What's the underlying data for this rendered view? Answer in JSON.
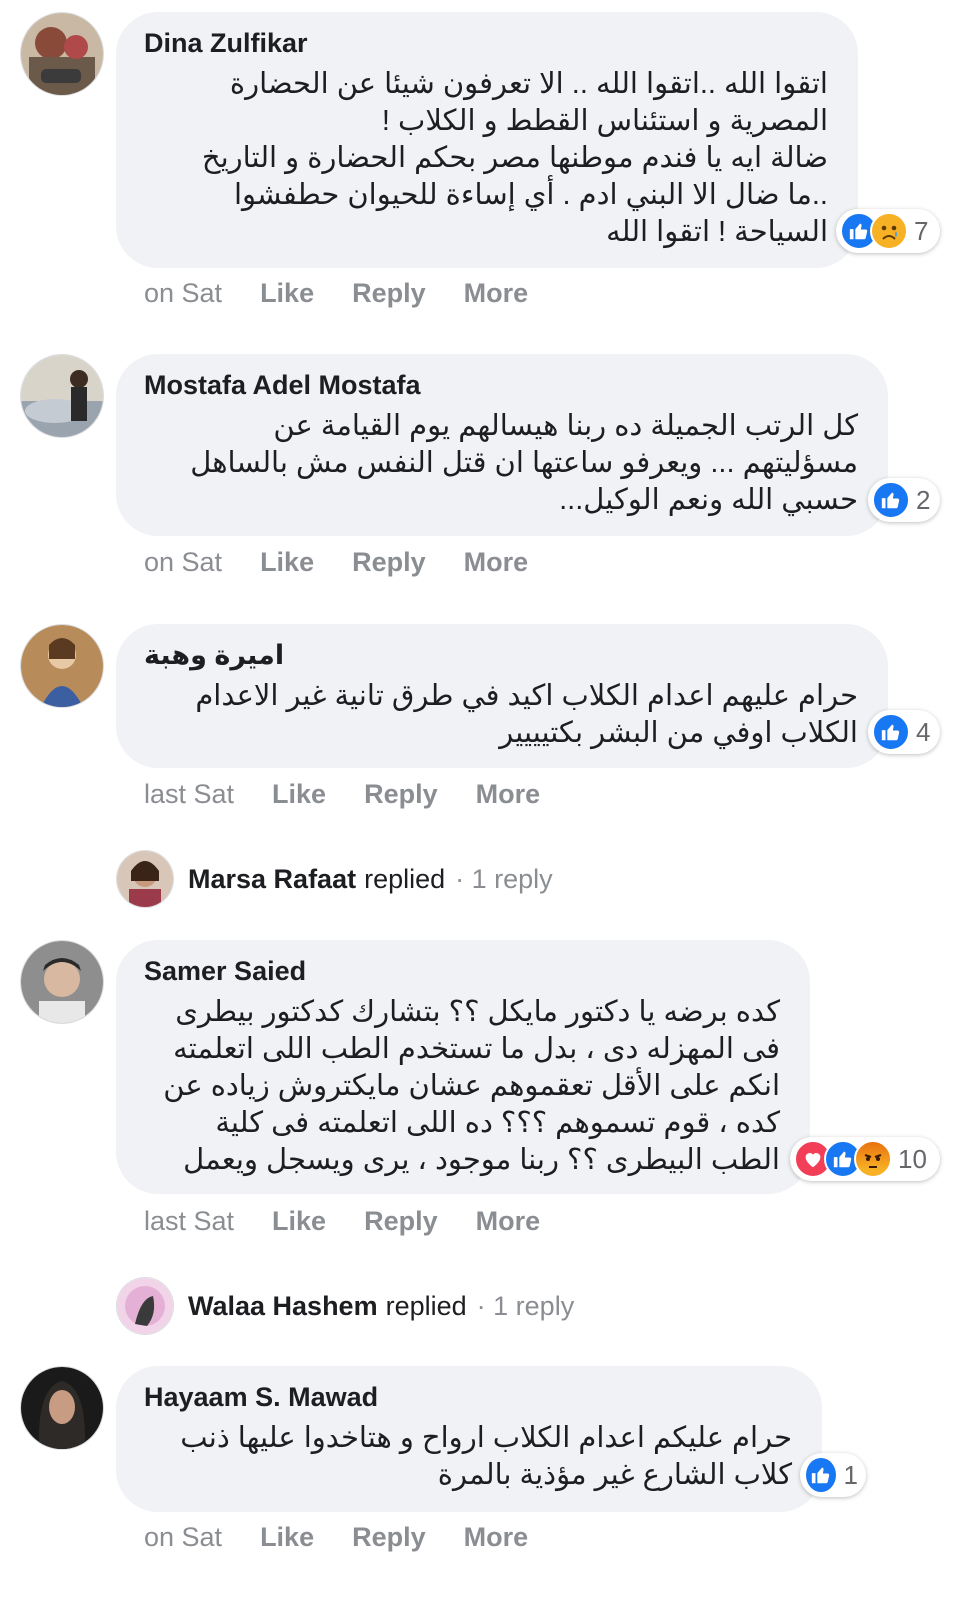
{
  "comments": [
    {
      "author": "Dina Zulfikar",
      "text": "اتقوا الله ..اتقوا الله .. الا تعرفون شيئا عن الحضارة\nالمصرية و استئناس القطط و الكلاب !\nضالة ايه يا فندم موطنها مصر بحكم الحضارة و التاريخ\n..ما ضال الا البني ادم . أي إساءة للحيوان حطفشوا\nالسياحة ! اتقوا الله",
      "reaction_count": "7",
      "reactions": [
        "like",
        "sad"
      ],
      "time": "on Sat",
      "like": "Like",
      "reply": "Reply",
      "more": "More"
    },
    {
      "author": "Mostafa Adel Mostafa",
      "text": "كل الرتب الجميلة ده ربنا هيسالهم يوم القيامة عن\nمسؤليتهم ... ويعرفو ساعتها ان قتل النفس مش بالساهل\nحسبي الله ونعم الوكيل...",
      "reaction_count": "2",
      "reactions": [
        "like"
      ],
      "time": "on Sat",
      "like": "Like",
      "reply": "Reply",
      "more": "More"
    },
    {
      "author": "اميرة وهبة",
      "text": "حرام عليهم اعدام الكلاب اكيد في طرق تانية غير الاعدام\nالكلاب اوفي من البشر بكتيييير",
      "reaction_count": "4",
      "reactions": [
        "like"
      ],
      "time": "last Sat",
      "like": "Like",
      "reply": "Reply",
      "more": "More"
    },
    {
      "author": "Samer Saied",
      "text": "كده برضه يا دكتور مايكل ؟؟ بتشارك كدكتور بيطرى\nفى المهزله دى ، بدل ما تستخدم الطب اللى اتعلمته\nانكم على الأقل تعقموهم عشان مايكتروش زياده عن\nكده ، قوم تسموهم ؟؟؟ ده اللى اتعلمته فى كلية\nالطب البيطرى ؟؟ ربنا موجود ، يرى ويسجل ويعمل",
      "reaction_count": "10",
      "reactions": [
        "love",
        "like",
        "angry"
      ],
      "time": "last Sat",
      "like": "Like",
      "reply": "Reply",
      "more": "More"
    },
    {
      "author": "Hayaam S. Mawad",
      "text": "حرام عليكم اعدام الكلاب ارواح و هتاخدوا عليها ذنب\nكلاب الشارع غير مؤذية بالمرة",
      "reaction_count": "1",
      "reactions": [
        "like"
      ],
      "time": "on Sat",
      "like": "Like",
      "reply": "Reply",
      "more": "More"
    }
  ],
  "replies": [
    {
      "name": "Marsa Rafaat",
      "verb": "replied",
      "count": "· 1 reply"
    },
    {
      "name": "Walaa Hashem",
      "verb": "replied",
      "count": "· 1 reply"
    }
  ],
  "colors": {
    "like": "#1877f2",
    "love": "#f33e58",
    "sad": "#f7b125",
    "angry": "#e9710f",
    "bubble": "#f0f2f5",
    "muted": "#8a8d91"
  }
}
